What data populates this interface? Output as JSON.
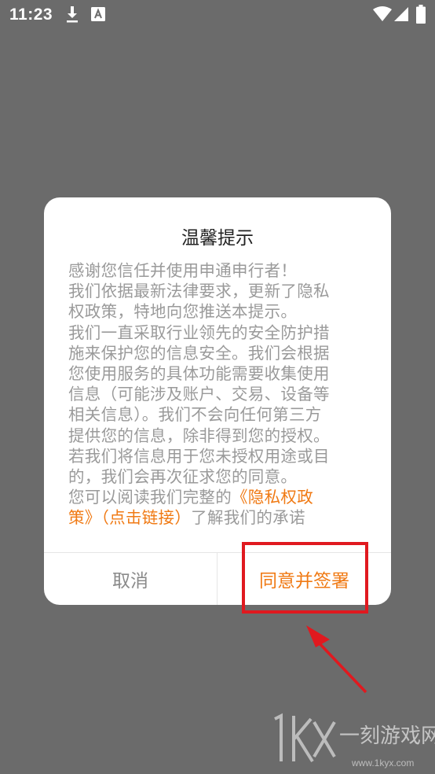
{
  "status_bar": {
    "time": "11:23",
    "icons": [
      "download-icon",
      "a-icon",
      "wifi-icon",
      "signal-icon",
      "battery-icon"
    ]
  },
  "dialog": {
    "title": "温馨提示",
    "body_lines": [
      "感谢您信任并使用申通申行者！",
      "我们依据最新法律要求，更新了隐私",
      "权政策，特地向您推送本提示。",
      "我们一直采取行业领先的安全防护措",
      "施来保护您的信息安全。我们会根据",
      "您使用服务的具体功能需要收集使用",
      "信息（可能涉及账户、交易、设备等",
      "相关信息）。我们不会向任何第三方",
      "提供您的信息，除非得到您的授权。",
      "若我们将信息用于您未授权用途或目",
      "的，我们会再次征求您的同意。"
    ],
    "last_line_prefix": "您可以阅读我们完整的",
    "link_part1": "《隐私权政",
    "link_part2": "策》（点击链接）",
    "last_line_suffix": "了解我们的承诺",
    "cancel_label": "取消",
    "agree_label": "同意并签署"
  },
  "annotation": {
    "highlight_color": "#e0191f"
  },
  "watermark": {
    "logo_text": "1KX",
    "site_name": "一刻游戏网",
    "url": "www.1kyx.com"
  },
  "colors": {
    "overlay": "#6b6b6b",
    "accent": "#f07a14",
    "body_text": "#9a9a9a"
  }
}
